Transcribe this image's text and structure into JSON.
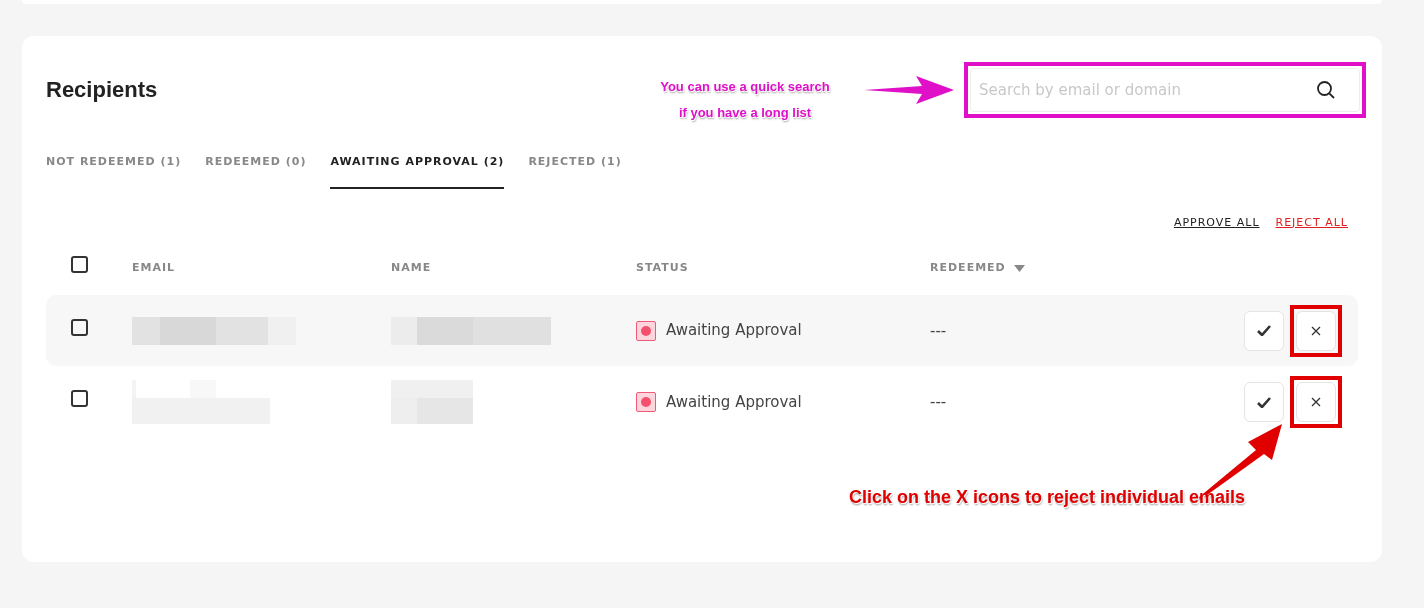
{
  "title": "Recipients",
  "search": {
    "placeholder": "Search by email or domain",
    "highlighted": true
  },
  "search_note": [
    "You can use a quick search",
    "if you have a long list"
  ],
  "tabs": [
    {
      "label": "NOT REDEEMED (1)",
      "selected": false
    },
    {
      "label": "REDEEMED (0)",
      "selected": false
    },
    {
      "label": "AWAITING APPROVAL (2)",
      "selected": true
    },
    {
      "label": "REJECTED (1)",
      "selected": false
    }
  ],
  "bulk_actions": [
    {
      "label": "APPROVE ALL",
      "kind": "approve"
    },
    {
      "label": "REJECT ALL",
      "kind": "reject"
    }
  ],
  "table": {
    "select_all": {
      "checked": false
    },
    "columns": [
      "EMAIL",
      "NAME",
      "STATUS",
      "REDEEMED"
    ],
    "rows": [
      {
        "checked": false,
        "hovered": true,
        "status": "Awaiting Approval",
        "redeemed": "---",
        "reject_highlighted": true
      },
      {
        "checked": false,
        "hovered": false,
        "status": "Awaiting Approval",
        "redeemed": "---",
        "reject_highlighted": true
      }
    ]
  },
  "reject_note": "Click on the X icons to reject individual emails"
}
